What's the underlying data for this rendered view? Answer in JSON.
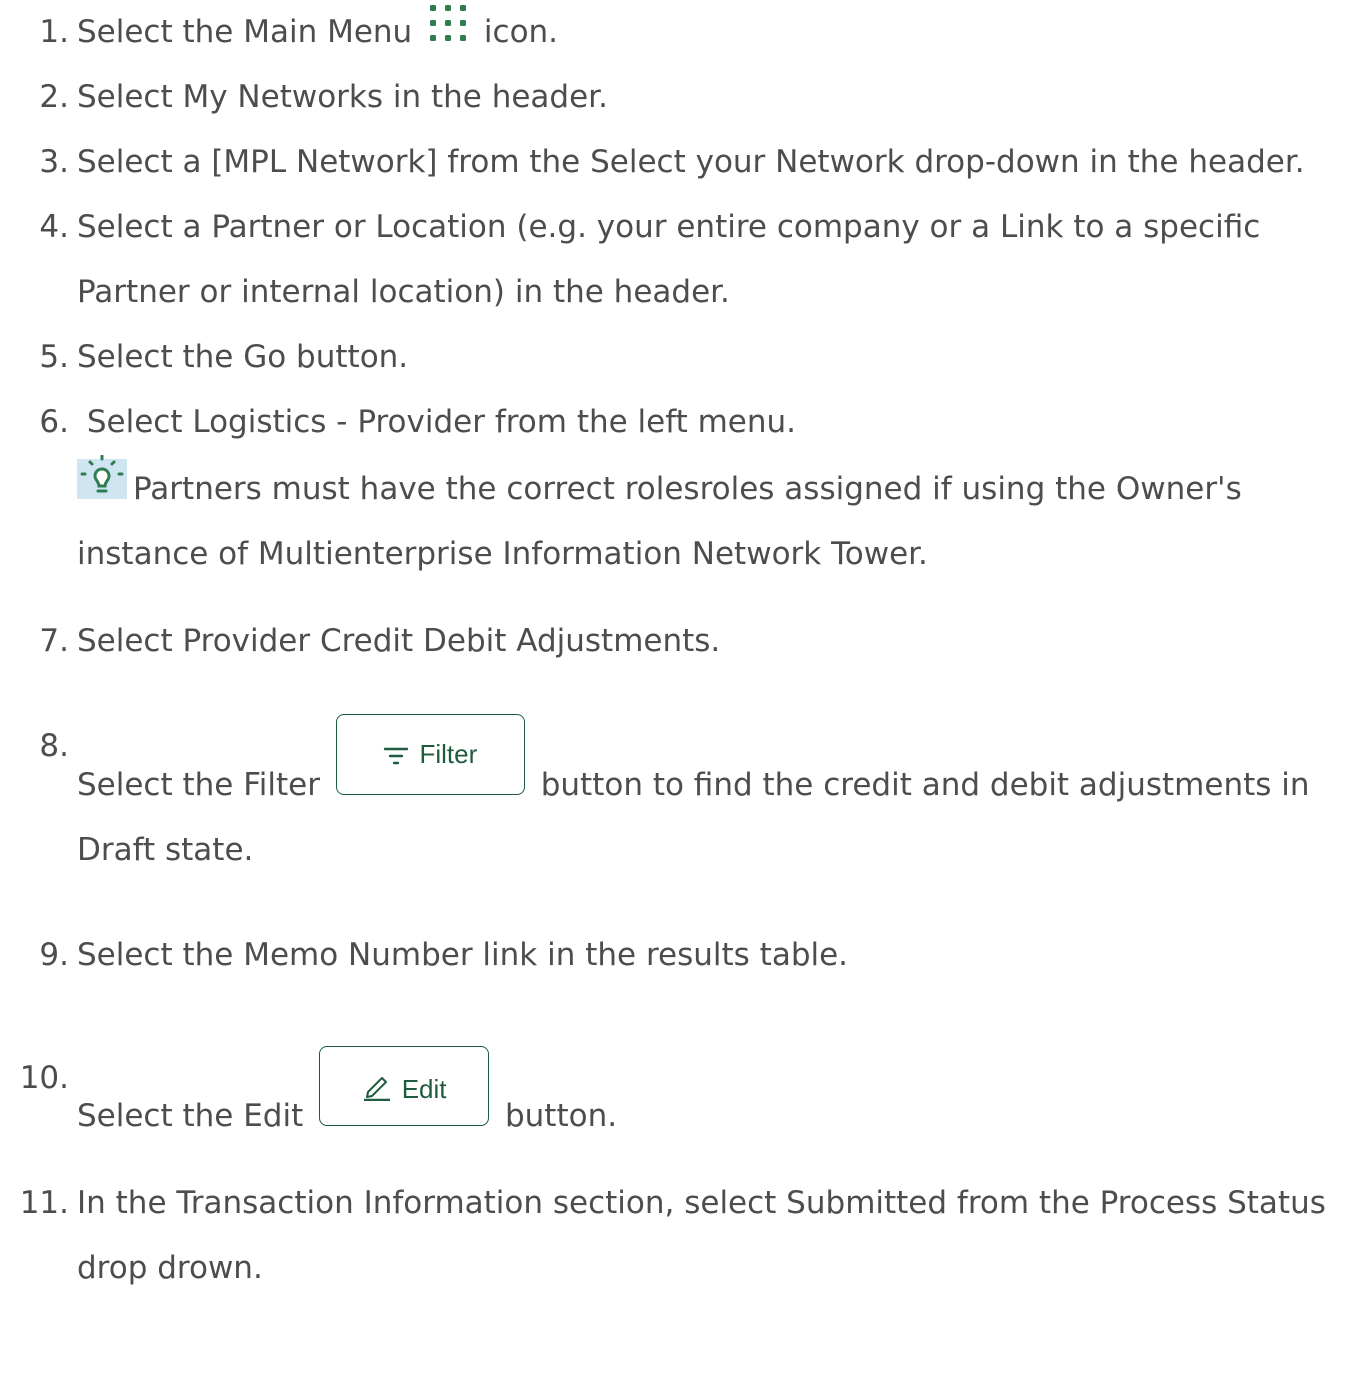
{
  "steps": [
    {
      "num": "1.",
      "text_before": "Select the Main Menu",
      "icon": "grid-dots-icon",
      "text_after": "icon."
    },
    {
      "num": "2.",
      "text": "Select My Networks in the header."
    },
    {
      "num": "3.",
      "text": "Select a [MPL Network] from the Select your Network drop-down in the header."
    },
    {
      "num": "4.",
      "text": "Select a Partner or Location (e.g. your entire company or a Link to a specific Partner or internal location) in the header."
    },
    {
      "num": "5.",
      "text": "Select the Go button."
    },
    {
      "num": "6.",
      "text": " Select Logistics - Provider from the left menu."
    },
    {
      "num": "7.",
      "text": "Select Provider Credit Debit Adjustments."
    },
    {
      "num": "8.",
      "text_before": "Select the Filter",
      "button_label": "Filter",
      "text_after": "button to find the credit and debit adjustments in Draft state."
    },
    {
      "num": "9.",
      "text": "Select the Memo Number link in the results table."
    },
    {
      "num": "10.",
      "text_before": "Select the Edit",
      "button_label": "Edit",
      "text_after": "button."
    },
    {
      "num": "11.",
      "text": "In the Transaction Information section, select Submitted from the Process Status drop drown."
    }
  ],
  "tip": {
    "icon": "lightbulb-icon",
    "text": "Partners must have the correct rolesroles assigned if using the Owner's instance of Multienterprise Information Network Tower."
  },
  "colors": {
    "text": "#4d4d4d",
    "accent_green": "#1f5c3f",
    "icon_green": "#2e7d4f",
    "tip_icon_bg": "#cfe6f2"
  }
}
